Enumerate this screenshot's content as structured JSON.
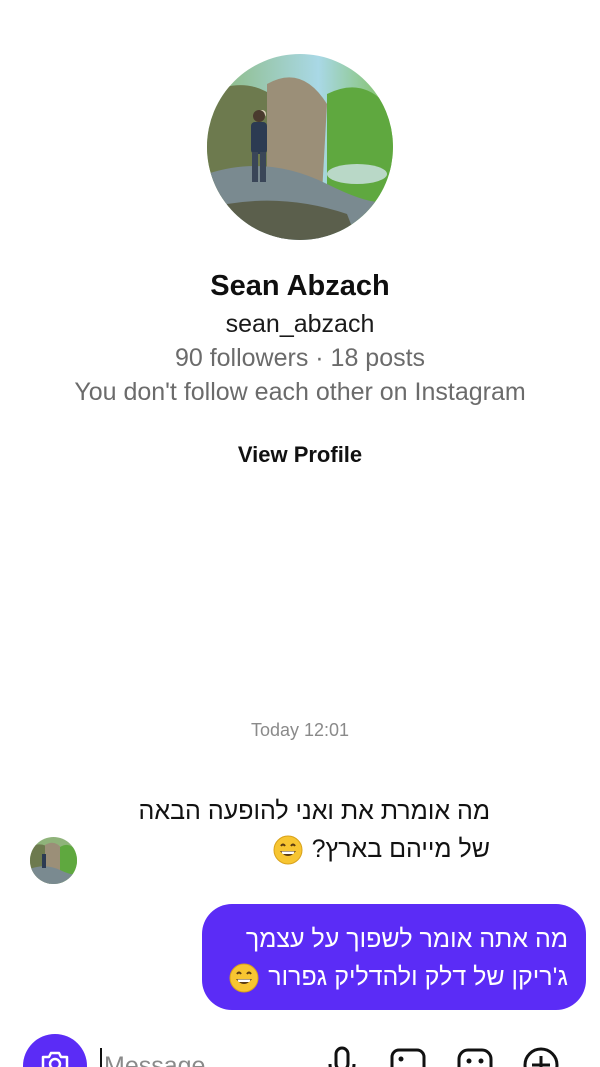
{
  "profile": {
    "name": "Sean Abzach",
    "username": "sean_abzach",
    "stats": "90 followers · 18 posts",
    "relation": "You don't follow each other on Instagram",
    "view_profile_label": "View Profile"
  },
  "chat": {
    "timestamp": "Today 12:01",
    "incoming": {
      "line1": "מה אומרת את ואני להופעה הבאה",
      "line2": "של מייהם בארץ?",
      "emoji": "grinning-face"
    },
    "outgoing": {
      "line1": "מה אתה אומר לשפוך על עצמך",
      "line2": "ג'ריקן של דלק ולהדליק גפרור",
      "emoji": "grinning-face"
    }
  },
  "composer": {
    "placeholder": "Message...",
    "icons": [
      "camera-icon",
      "microphone-icon",
      "gallery-icon",
      "sticker-icon",
      "plus-icon"
    ]
  },
  "colors": {
    "accent": "#5b2cf6",
    "secondary_text": "#6b6b6b",
    "timestamp": "#8a8a8a"
  }
}
